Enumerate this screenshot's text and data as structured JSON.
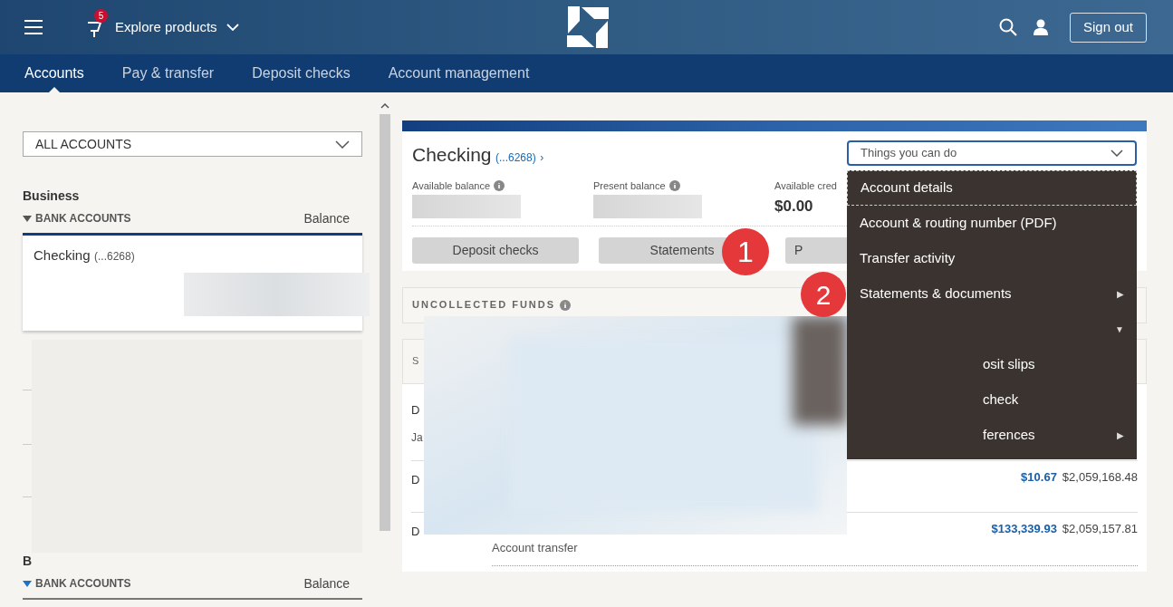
{
  "header": {
    "notification_count": "5",
    "explore_label": "Explore products",
    "sign_out": "Sign out"
  },
  "nav_tabs": [
    {
      "label": "Accounts",
      "selected": true
    },
    {
      "label": "Pay & transfer",
      "selected": false
    },
    {
      "label": "Deposit checks",
      "selected": false
    },
    {
      "label": "Account management",
      "selected": false
    }
  ],
  "sidebar": {
    "filter": "ALL ACCOUNTS",
    "groups": [
      {
        "heading": "Business",
        "section": "BANK ACCOUNTS",
        "balance_header": "Balance",
        "highlighted": false,
        "accounts": [
          {
            "name": "Checking",
            "number": "(...6268)",
            "selected": true
          }
        ]
      },
      {
        "heading": "B",
        "section": "BANK ACCOUNTS",
        "balance_header": "Balance",
        "highlighted": true
      }
    ]
  },
  "account_panel": {
    "title": "Checking",
    "number": "(...6268)",
    "link_arrow": "›",
    "balances": [
      {
        "label": "Available balance",
        "info": true
      },
      {
        "label": "Present balance",
        "info": true
      },
      {
        "label": "Available cred",
        "info": false,
        "value": "$0.00"
      }
    ],
    "actions": [
      "Deposit checks",
      "Statements",
      "P"
    ],
    "things_menu": {
      "label": "Things you can do",
      "items": [
        {
          "label": "Account details",
          "focused": true
        },
        {
          "label": "Account & routing number (PDF)",
          "focused": false
        },
        {
          "label": "Transfer activity",
          "focused": false
        },
        {
          "label": "Statements & documents",
          "focused": false,
          "arrow": "▶"
        },
        {
          "focused": false,
          "arrow": "▼"
        },
        {
          "label": "osit slips",
          "focused": false
        },
        {
          "label": "check",
          "focused": false
        },
        {
          "label": "ferences",
          "focused": false,
          "arrow": "▶"
        }
      ]
    },
    "uncollected_label": "UNCOLLECTED FUNDS",
    "second_section_label": "S",
    "transactions": [
      {
        "date": "D",
        "description": "Ja"
      },
      {
        "date": "D",
        "amount": "$10.67",
        "balance": "$2,059,168.48"
      },
      {
        "date": "D",
        "amount": "$133,339.93",
        "balance": "$2,059,157.81",
        "type": "Account transfer"
      }
    ]
  },
  "callouts": [
    "1",
    "2"
  ]
}
